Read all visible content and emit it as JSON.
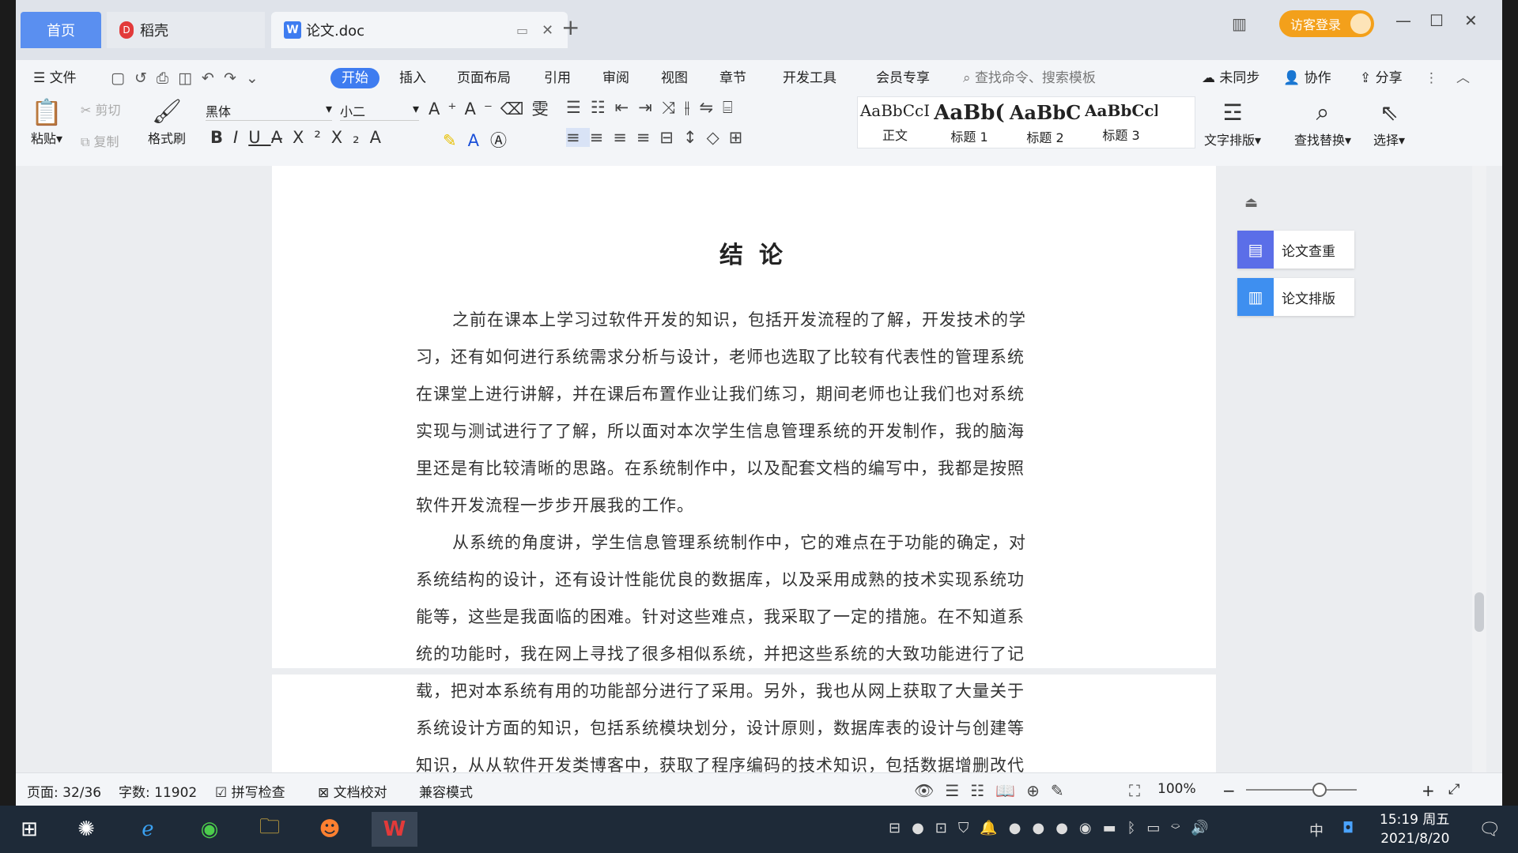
{
  "tabs": {
    "home": "首页",
    "docer": "稻壳",
    "doc": "论文.doc",
    "new": "+"
  },
  "window": {
    "login": "访客登录"
  },
  "menu": {
    "file": "文件",
    "start": "开始",
    "insert": "插入",
    "layout": "页面布局",
    "ref": "引用",
    "review": "审阅",
    "view": "视图",
    "chapter": "章节",
    "dev": "开发工具",
    "member": "会员专享",
    "search_placeholder": "查找命令、搜索模板",
    "unsync": "未同步",
    "collab": "协作",
    "share": "分享"
  },
  "ribbon": {
    "paste": "粘贴",
    "cut": "剪切",
    "copy": "复制",
    "format_painter": "格式刷",
    "font": "黑体",
    "size": "小二",
    "text_layout": "文字排版",
    "find_replace": "查找替换",
    "select": "选择"
  },
  "styles": [
    {
      "preview": "AaBbCcI",
      "label": "正文"
    },
    {
      "preview": "AaBb(",
      "label": "标题 1"
    },
    {
      "preview": "AaBbC",
      "label": "标题 2"
    },
    {
      "preview": "AaBbCcl",
      "label": "标题 3"
    }
  ],
  "doc": {
    "title": "结论",
    "p1": [
      "之前在课本上学习过软件开发的知识，包括开发流程的了解，开发技术的学",
      "习，还有如何进行系统需求分析与设计，老师也选取了比较有代表性的管理系统",
      "在课堂上进行讲解，并在课后布置作业让我们练习，期间老师也让我们也对系统",
      "实现与测试进行了了解，所以面对本次学生信息管理系统的开发制作，我的脑海",
      "里还是有比较清晰的思路。在系统制作中，以及配套文档的编写中，我都是按照",
      "软件开发流程一步步开展我的工作。"
    ],
    "p2": [
      "从系统的角度讲，学生信息管理系统制作中，它的难点在于功能的确定，对",
      "系统结构的设计，还有设计性能优良的数据库，以及采用成熟的技术实现系统功",
      "能等，这些是我面临的困难。针对这些难点，我采取了一定的措施。在不知道系",
      "统的功能时，我在网上寻找了很多相似系统，并把这些系统的大致功能进行了记",
      "载，把对本系统有用的功能部分进行了采用。另外，我也从网上获取了大量关于",
      "系统设计方面的知识，包括系统模块划分，设计原则，数据库表的设计与创建等",
      "知识，从从软件开发类博客中，获取了程序编码的技术知识，包括数据增删改代"
    ]
  },
  "panel": {
    "check": "论文查重",
    "typeset": "论文排版"
  },
  "status": {
    "page": "页面: 32/36",
    "words": "字数: 11902",
    "spell": "拼写检查",
    "proof": "文档校对",
    "compat": "兼容模式",
    "zoom": "100%"
  },
  "taskbar": {
    "time": "15:19 周五",
    "date": "2021/8/20",
    "ime": "中"
  }
}
